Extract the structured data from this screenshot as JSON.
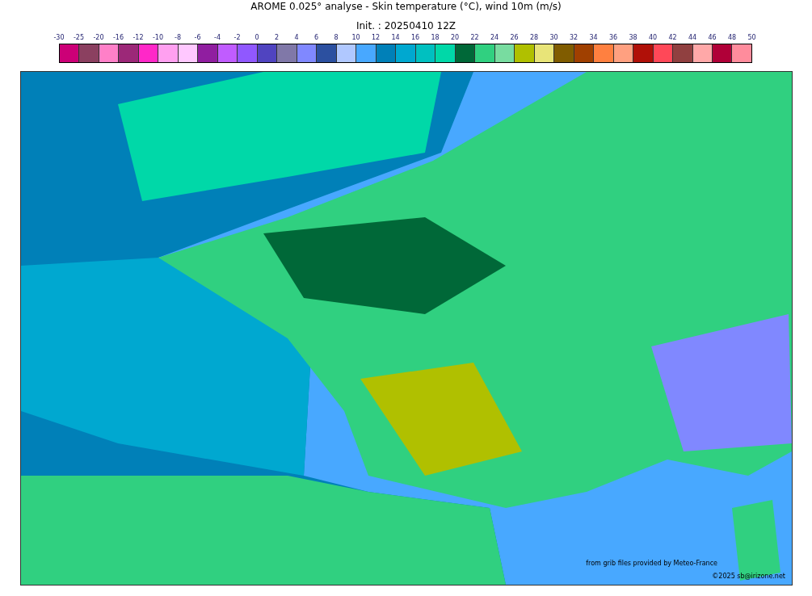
{
  "title": "AROME 0.025° analyse - Skin temperature (°C), wind 10m (m/s)",
  "subtitle": "Init. : 20250410 12Z",
  "colorbar": {
    "labels": [
      "-30",
      "-25",
      "-20",
      "-16",
      "-12",
      "-10",
      "-8",
      "-6",
      "-4",
      "-2",
      "0",
      "2",
      "4",
      "6",
      "8",
      "10",
      "12",
      "14",
      "16",
      "18",
      "20",
      "22",
      "24",
      "26",
      "28",
      "30",
      "32",
      "34",
      "36",
      "38",
      "40",
      "42",
      "44",
      "46",
      "48",
      "50"
    ],
    "bins": [
      {
        "color": "#cc0077"
      },
      {
        "color": "#8b4060"
      },
      {
        "color": "#ff80c8"
      },
      {
        "color": "#9c2878"
      },
      {
        "color": "#ff28c8"
      },
      {
        "color": "#ffa0f0"
      },
      {
        "color": "#ffc8ff"
      },
      {
        "color": "#901ea0"
      },
      {
        "color": "#c05cff"
      },
      {
        "color": "#9058ff"
      },
      {
        "color": "#5044c0"
      },
      {
        "color": "#8078a8"
      },
      {
        "color": "#8088ff"
      },
      {
        "color": "#2c50a0"
      },
      {
        "color": "#b0c8ff"
      },
      {
        "color": "#48a8ff"
      },
      {
        "color": "#0080b8"
      },
      {
        "color": "#00a8d0"
      },
      {
        "color": "#00c0c0"
      },
      {
        "color": "#00d8a8"
      },
      {
        "color": "#006838"
      },
      {
        "color": "#30d080"
      },
      {
        "color": "#78dca0"
      },
      {
        "color": "#b0c000"
      },
      {
        "color": "#e8e478"
      },
      {
        "color": "#805c00"
      },
      {
        "color": "#a04000"
      },
      {
        "color": "#ff8040"
      },
      {
        "color": "#ffa080"
      },
      {
        "color": "#b01008"
      },
      {
        "color": "#ff4858"
      },
      {
        "color": "#904040"
      },
      {
        "color": "#ffa8a8"
      },
      {
        "color": "#b00038"
      },
      {
        "color": "#ff8c9c"
      }
    ]
  },
  "credits": [
    "from grib files provided by Meteo-France",
    "©2025 sb@irizone.net"
  ]
}
